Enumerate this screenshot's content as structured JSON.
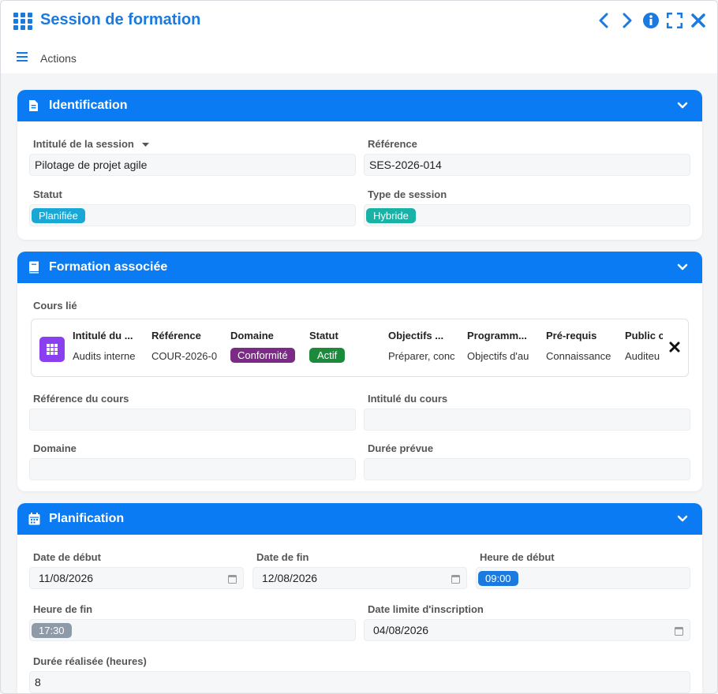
{
  "window": {
    "title": "Session de formation"
  },
  "toolbar": {
    "actions_label": "Actions"
  },
  "identification": {
    "title": "Identification",
    "intitule_label": "Intitulé de la session",
    "intitule_value": "Pilotage de projet agile",
    "reference_label": "Référence",
    "reference_value": "SES-2026-014",
    "statut_label": "Statut",
    "statut_value": "Planifiée",
    "type_label": "Type de session",
    "type_value": "Hybride"
  },
  "formation": {
    "title": "Formation associée",
    "cours_lie_label": "Cours lié",
    "linked_columns": [
      {
        "header": "Intitulé du ...",
        "value": "Audits interne"
      },
      {
        "header": "Référence",
        "value": "COUR-2026-0"
      },
      {
        "header": "Domaine",
        "value": "Conformité"
      },
      {
        "header": "Statut",
        "value": "Actif"
      },
      {
        "header": "Objectifs ...",
        "value": "Préparer, conc"
      },
      {
        "header": "Programm...",
        "value": "Objectifs d'au"
      },
      {
        "header": "Pré-requis",
        "value": "Connaissance"
      },
      {
        "header": "Public c",
        "value": "Auditeu"
      }
    ],
    "ref_cours_label": "Référence du cours",
    "ref_cours_value": "",
    "intitule_cours_label": "Intitulé du cours",
    "intitule_cours_value": "",
    "domaine_label": "Domaine",
    "domaine_value": "",
    "duree_prevue_label": "Durée prévue",
    "duree_prevue_value": ""
  },
  "planification": {
    "title": "Planification",
    "date_debut_label": "Date de début",
    "date_debut_value": "11/08/2026",
    "date_fin_label": "Date de fin",
    "date_fin_value": "12/08/2026",
    "heure_debut_label": "Heure de début",
    "heure_debut_value": "09:00",
    "heure_fin_label": "Heure de fin",
    "heure_fin_value": "17:30",
    "date_limite_label": "Date limite d'inscription",
    "date_limite_value": "04/08/2026",
    "duree_realisee_label": "Durée réalisée (heures)",
    "duree_realisee_value": "8"
  },
  "colors": {
    "brand_blue": "#1a7ae0",
    "header_blue": "#0a7bf3",
    "planifiee": "#19a7d6",
    "hybride": "#19b2a6",
    "conformite": "#7b2b86",
    "actif": "#1b8a3a",
    "heure_debut": "#1a7ae0",
    "heure_fin": "#8e9aa8",
    "linked_icon": "#8a3ff0"
  },
  "icons": [
    "grid-icon",
    "chevron-left-icon",
    "chevron-right-icon",
    "info-icon",
    "fullscreen-icon",
    "close-icon",
    "hamburger-icon",
    "document-icon",
    "book-icon",
    "calendar-icon",
    "chevron-down-icon",
    "caret-down-icon"
  ]
}
